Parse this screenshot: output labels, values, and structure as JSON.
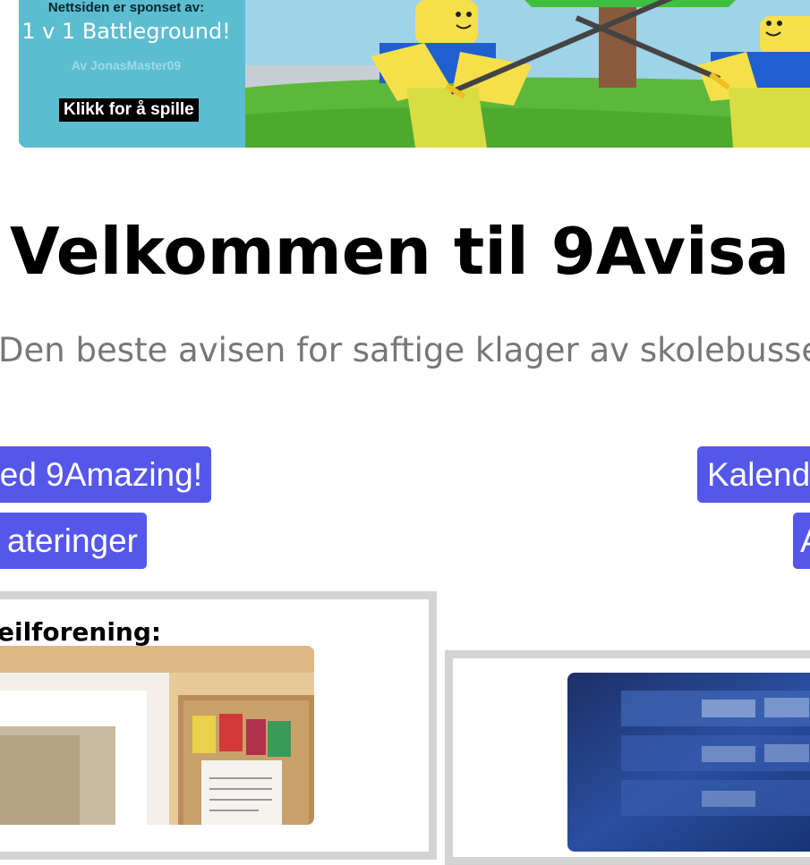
{
  "banner": {
    "sponsor_line": "Nettsiden er sponset av:",
    "game_title": "1 v 1 Battleground!",
    "author": "Av JonasMaster09",
    "play_label": "Klikk for å spille"
  },
  "header": {
    "title": "Velkommen til 9Avisa",
    "tagline": "Den beste avisen for saftige klager av skolebussen"
  },
  "nav": {
    "amazing_label": "ed 9Amazing!",
    "kalender_label": "Kalend",
    "oppdateringer_label": "ateringer",
    "right_label": "A"
  },
  "cards": {
    "left_heading": "eilforening:"
  },
  "colors": {
    "nav_button": "#5557ea",
    "tagline": "#777777",
    "card_border": "#d3d3d3",
    "banner_bg": "#5cbdd0"
  }
}
